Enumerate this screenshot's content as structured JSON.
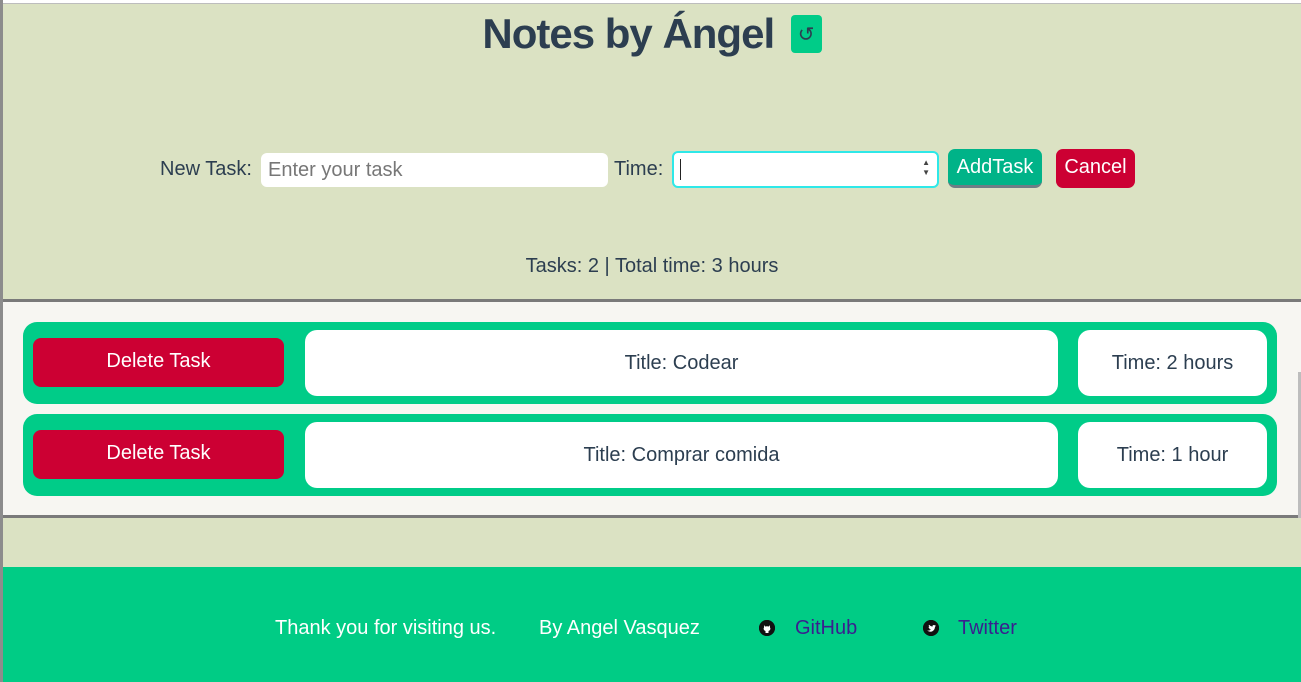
{
  "header": {
    "title": "Notes by Ángel",
    "refresh_icon": "↺"
  },
  "form": {
    "task_label": "New Task:",
    "task_placeholder": "Enter your task",
    "task_value": "",
    "time_label": "Time:",
    "time_value": "",
    "add_label": "AddTask",
    "cancel_label": "Cancel"
  },
  "summary": "Tasks: 2 | Total time: 3 hours",
  "tasks": [
    {
      "delete_label": "Delete Task",
      "title": "Title: Codear",
      "time": "Time: 2 hours"
    },
    {
      "delete_label": "Delete Task",
      "title": "Title: Comprar comida",
      "time": "Time: 1 hour"
    }
  ],
  "footer": {
    "thanks": "Thank you for visiting us.",
    "author": "By Angel Vasquez",
    "github_label": "GitHub",
    "twitter_label": "Twitter",
    "github_icon": "github-icon",
    "twitter_icon": "twitter-icon"
  },
  "colors": {
    "page_bg": "#dbe2c3",
    "accent_green": "#00cc88",
    "danger_red": "#cc0033",
    "text_dark": "#2c3e50",
    "link_purple": "#3a1f8f",
    "focus_cyan": "#2ee8e8"
  }
}
